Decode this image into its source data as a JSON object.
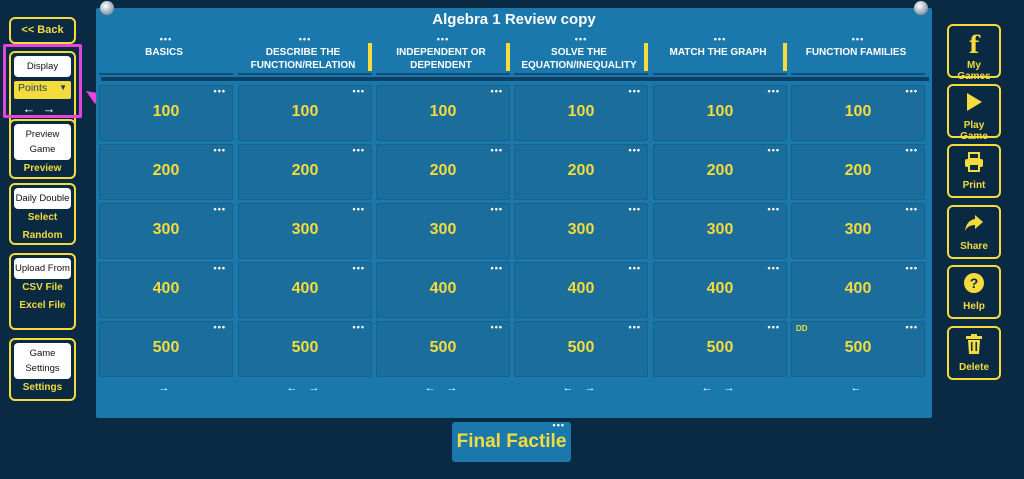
{
  "board": {
    "title": "Algebra 1 Review copy",
    "categories": [
      {
        "label": "BASICS",
        "nav": "→"
      },
      {
        "label": "DESCRIBE THE FUNCTION/RELATION",
        "nav": "← →"
      },
      {
        "label": "INDEPENDENT OR DEPENDENT",
        "nav": "← →"
      },
      {
        "label": "SOLVE THE EQUATION/INEQUALITY",
        "nav": "← →"
      },
      {
        "label": "MATCH THE GRAPH",
        "nav": "← →"
      },
      {
        "label": "FUNCTION FAMILIES",
        "nav": "←"
      }
    ],
    "values": [
      "100",
      "200",
      "300",
      "400",
      "500"
    ],
    "dots": "•••",
    "daily_double_tag": "DD"
  },
  "left": {
    "back": "<< Back",
    "display_label": "Display",
    "display_select": "Points",
    "arrows": "←→",
    "preview_white": "Preview Game",
    "preview_link": "Preview",
    "daily_white": "Daily Double",
    "daily_select": "Select",
    "daily_random": "Random",
    "upload_white": "Upload From",
    "upload_csv": "CSV File",
    "upload_excel": "Excel File",
    "settings_white": "Game Settings",
    "settings_link": "Settings"
  },
  "right": {
    "my_games": "My Games",
    "play_game": "Play Game",
    "print": "Print",
    "share": "Share",
    "help": "Help",
    "delete": "Delete"
  },
  "final": "Final Factile",
  "colors": {
    "accent": "#f5dc3c",
    "board": "#1b78ac",
    "background": "#0a2a44",
    "highlight": "#e545d8"
  }
}
